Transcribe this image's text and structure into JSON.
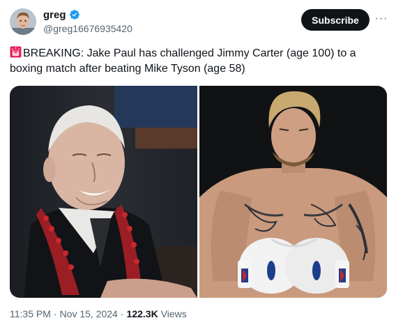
{
  "author": {
    "display_name": "greg",
    "handle": "@greg16676935420",
    "verified": true,
    "avatar_icon": "avatar-photo"
  },
  "actions": {
    "subscribe_label": "Subscribe",
    "more_icon": "more-dots-icon",
    "more_glyph": "···"
  },
  "tweet": {
    "emoji": "siren-emoji",
    "text": "BREAKING: Jake Paul has challenged Jimmy Carter (age 100) to a boxing match after beating Mike Tyson (age 58)"
  },
  "media": [
    {
      "icon": "photo-elderly-man"
    },
    {
      "icon": "photo-boxer"
    }
  ],
  "meta": {
    "time": "11:35 PM",
    "separator": "·",
    "date": "Nov 15, 2024",
    "views_count": "122.3K",
    "views_label": "Views"
  },
  "colors": {
    "text": "#0f1419",
    "secondary": "#536471",
    "verified": "#1d9bf0",
    "button": "#0f1419"
  }
}
